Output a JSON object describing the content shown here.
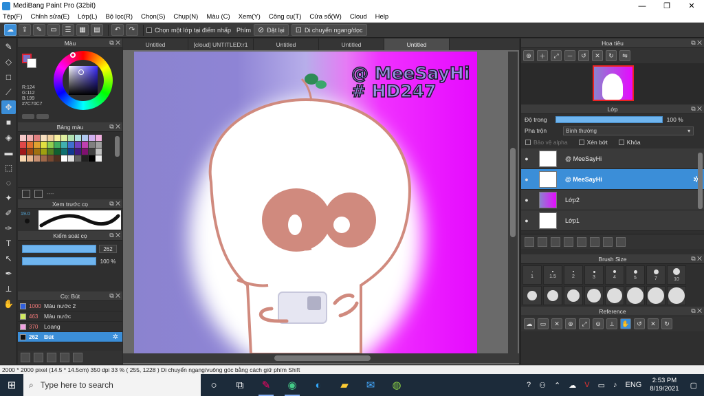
{
  "window": {
    "title": "MediBang Paint Pro (32bit)",
    "min": "—",
    "max": "❐",
    "close": "✕"
  },
  "menu": [
    "Tệp(F)",
    "Chỉnh sửa(E)",
    "Lớp(L)",
    "Bộ lọc(R)",
    "Chọn(S)",
    "Chụp(N)",
    "Màu (C)",
    "Xem(Y)",
    "Công cụ(T)",
    "Cửa sổ(W)",
    "Cloud",
    "Help"
  ],
  "toolbar": {
    "check_label": "Chọn một lớp tại điểm nhấp",
    "phim_label": "Phím",
    "reset_label": "Đặt lại",
    "move_label": "Di chuyển ngang/dọc"
  },
  "color_panel": {
    "title": "Màu",
    "r": "R:124",
    "g": "G:112",
    "b": "B:199",
    "hex": "#7C70C7",
    "fg_color": "#7c70c7"
  },
  "palette_panel": {
    "title": "Bảng màu",
    "empty_text": "----",
    "swatches": [
      "#f5c8c8",
      "#f0b0b0",
      "#e08080",
      "#f8e0c0",
      "#f0d0a0",
      "#f8f0a0",
      "#e0f0a0",
      "#b0e0b0",
      "#b0e0e0",
      "#b0c8f0",
      "#d0b0f0",
      "#f0b0e0",
      "#e04848",
      "#e07030",
      "#e0a030",
      "#e0e040",
      "#90d050",
      "#40b060",
      "#40b0b0",
      "#4070d0",
      "#7040c0",
      "#c040b0",
      "#808080",
      "#a0a0a0",
      "#a01818",
      "#a04810",
      "#a07010",
      "#a0a010",
      "#508020",
      "#106030",
      "#107070",
      "#103890",
      "#401880",
      "#801070",
      "#404040",
      "#c0c0c0",
      "#f8d8b0",
      "#e8b890",
      "#c89070",
      "#a06848",
      "#784830",
      "#503020",
      "#ffffff",
      "#e0e0e0",
      "#606060",
      "#202020",
      "#000000",
      "#f0f0f0"
    ]
  },
  "brush_preview": {
    "title": "Xem trước cọ",
    "size": "19.0"
  },
  "brush_control": {
    "title": "Kiểm soát cọ",
    "size_value": "262",
    "opacity_value": "100 %"
  },
  "brush_panel": {
    "title": "Cọ: Bút",
    "items": [
      {
        "num": "1000",
        "name": "Màu nước 2",
        "color": "#3060e0"
      },
      {
        "num": "463",
        "name": "Màu nước",
        "color": "#d0e860"
      },
      {
        "num": "370",
        "name": "Loang",
        "color": "#f0a0e0"
      },
      {
        "num": "262",
        "name": "Bút",
        "color": "#111111"
      }
    ]
  },
  "tabs": [
    "Untitled",
    "[cloud] UNTITLED:r1",
    "Untitled",
    "Untitled",
    "Untitled"
  ],
  "artwork": {
    "line1": "@ MeeSayHi",
    "line2": "# HD247"
  },
  "navigator": {
    "title": "Hoa tiêu"
  },
  "layers": {
    "title": "Lớp",
    "opacity_label": "Độ trong",
    "opacity_value": "100 %",
    "blend_label": "Pha trộn",
    "blend_value": "Bình thường",
    "protect_alpha": "Bảo vệ alpha",
    "clipping": "Xén bớt",
    "lock": "Khóa",
    "items": [
      {
        "name": "@ MeeSayHi"
      },
      {
        "name": "@ MeeSayHi"
      },
      {
        "name": "Lớp2"
      },
      {
        "name": "Lớp1"
      }
    ]
  },
  "brush_size": {
    "title": "Brush Size",
    "sizes": [
      "1",
      "1.5",
      "2",
      "3",
      "4",
      "5",
      "7",
      "10"
    ]
  },
  "reference": {
    "title": "Reference"
  },
  "status": {
    "text": "2000 * 2000 pixel  (14.5 * 14.5cm)  350 dpi  33 %  ( 255, 1228 )  Di chuyển ngang/vuông góc bằng cách giữ phím Shift"
  },
  "taskbar": {
    "search_placeholder": "Type here to search",
    "lang": "ENG",
    "time": "2:53 PM",
    "date": "8/19/2021"
  }
}
